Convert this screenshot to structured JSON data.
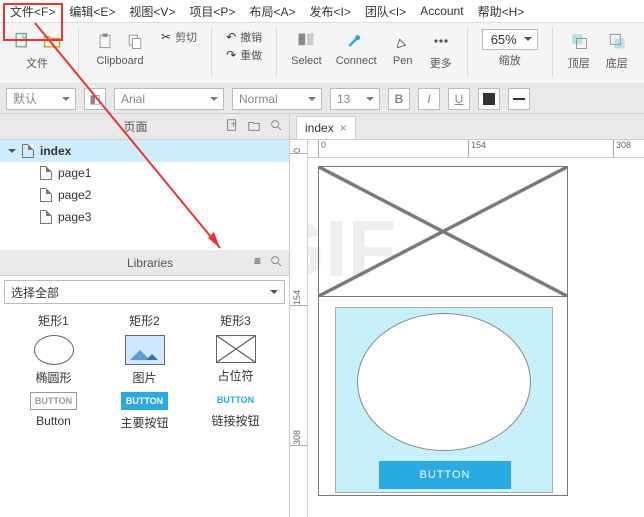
{
  "menu": {
    "file": "文件<F>",
    "edit": "编辑<E>",
    "view": "视图<V>",
    "project": "项目<P>",
    "layout": "布局<A>",
    "publish": "发布<I>",
    "team": "团队<I>",
    "account": "Account",
    "help": "帮助<H>"
  },
  "toolbar": {
    "file": "文件",
    "clipboard": "Clipboard",
    "cut": "剪切",
    "undo": "撤销",
    "redo": "重做",
    "select": "Select",
    "connect": "Connect",
    "pen": "Pen",
    "more": "更多",
    "zoom_value": "65%",
    "zoom_label": "缩放",
    "front": "顶层",
    "back": "底层"
  },
  "format": {
    "style": "默认",
    "font": "Arial",
    "weight": "Normal",
    "size": "13",
    "bold": "B",
    "italic": "I",
    "underline": "U"
  },
  "pages_panel": {
    "title": "页面",
    "items": [
      {
        "name": "index",
        "children": [
          "page1",
          "page2",
          "page3"
        ]
      }
    ]
  },
  "libraries_panel": {
    "title": "Libraries",
    "selector": "选择全部",
    "items": [
      {
        "label": "矩形1"
      },
      {
        "label": "矩形2"
      },
      {
        "label": "矩形3"
      },
      {
        "label": "椭圆形"
      },
      {
        "label": "图片"
      },
      {
        "label": "占位符"
      },
      {
        "label": "Button"
      },
      {
        "label": "主要按钮"
      },
      {
        "label": "链接按钮"
      }
    ],
    "btn_glyph": "BUTTON"
  },
  "canvas": {
    "tab": "index",
    "hruler": [
      {
        "v": "0",
        "p": 10
      },
      {
        "v": "154",
        "p": 160
      },
      {
        "v": "308",
        "p": 305
      }
    ],
    "vruler": [
      {
        "v": "0",
        "p": 8
      },
      {
        "v": "154",
        "p": 150
      },
      {
        "v": "308",
        "p": 290
      }
    ],
    "button_label": "BUTTON",
    "watermark": "GIF"
  }
}
